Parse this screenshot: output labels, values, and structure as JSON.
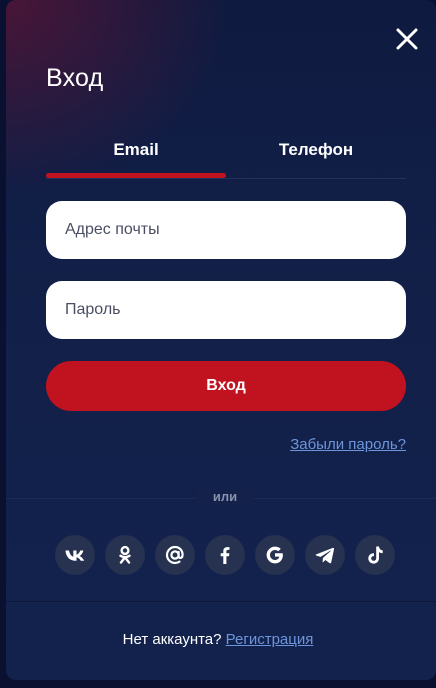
{
  "modal": {
    "title": "Вход",
    "close_icon": "close-icon"
  },
  "tabs": [
    {
      "label": "Email",
      "active": true
    },
    {
      "label": "Телефон",
      "active": false
    }
  ],
  "form": {
    "email_placeholder": "Адрес почты",
    "email_value": "",
    "password_placeholder": "Пароль",
    "password_value": "",
    "submit_label": "Вход",
    "forgot_link": "Забыли пароль?"
  },
  "divider_text": "или",
  "social": [
    {
      "name": "vk",
      "icon": "vk-icon"
    },
    {
      "name": "odnoklassniki",
      "icon": "odnoklassniki-icon"
    },
    {
      "name": "mail",
      "icon": "at-sign-icon"
    },
    {
      "name": "facebook",
      "icon": "facebook-icon"
    },
    {
      "name": "google",
      "icon": "google-icon"
    },
    {
      "name": "telegram",
      "icon": "telegram-icon"
    },
    {
      "name": "tiktok",
      "icon": "tiktok-icon"
    }
  ],
  "footer": {
    "question": "Нет аккаунта?",
    "register_link": "Регистрация"
  },
  "colors": {
    "accent_red": "#c1121f",
    "link_blue": "#6e95d9",
    "background_navy": "#122049",
    "social_circle": "#26324f"
  }
}
